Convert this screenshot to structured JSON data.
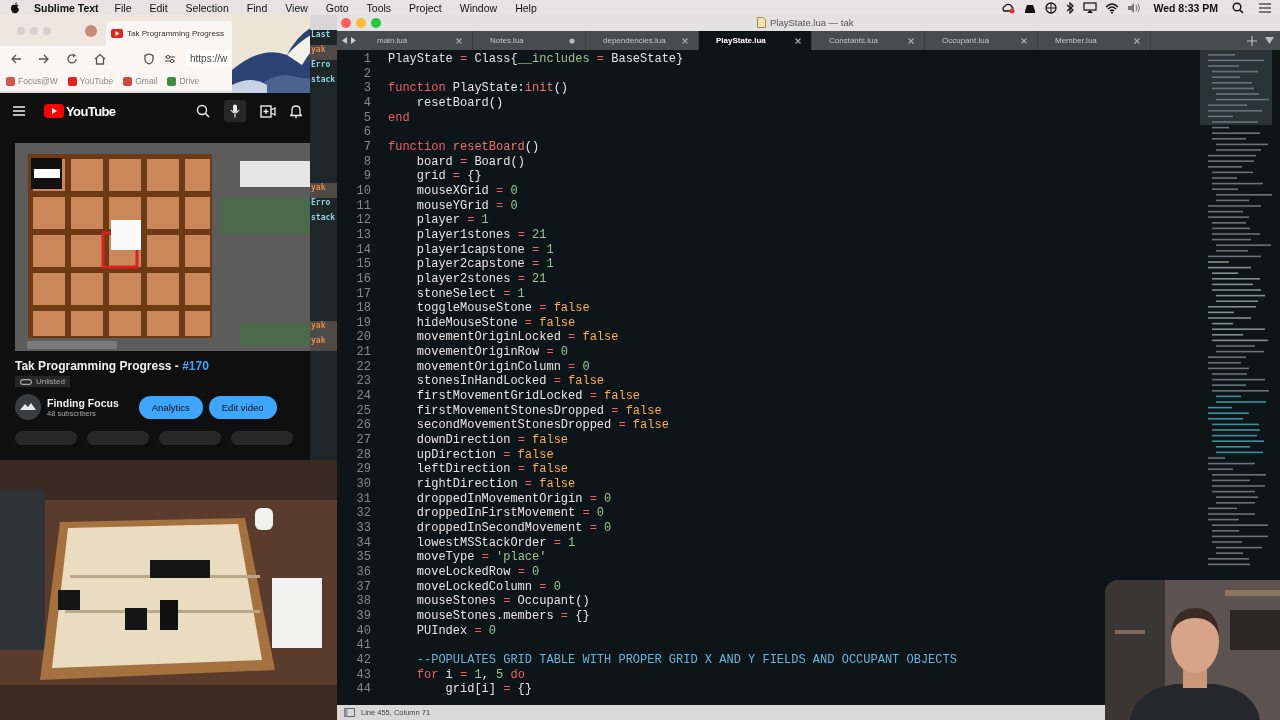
{
  "menu_bar": {
    "app": "Sublime Text",
    "menus": [
      "File",
      "Edit",
      "Selection",
      "Find",
      "View",
      "Goto",
      "Tools",
      "Project",
      "Window",
      "Help"
    ],
    "clock": "Wed 8:33 PM"
  },
  "browser": {
    "tab_title": "Tak Programming Progress",
    "address": "https://w",
    "bookmarks": [
      "Focus@W",
      "YouTube",
      "Gmail",
      "Drive"
    ],
    "youtube": {
      "logo": "YouTube",
      "video": {
        "title": "Tak Programming Progress - ",
        "tag": "#170",
        "visibility": "Unlisted",
        "channel": "Finding Focus",
        "subscribers": "48 subscribers",
        "buttons": [
          "Analytics",
          "Edit video"
        ]
      }
    }
  },
  "terminal": {
    "blocks": [
      {
        "lines": [
          {
            "text": "Last",
            "kind": "info"
          },
          {
            "text": "yak",
            "kind": "warn"
          },
          {
            "text": "Erro",
            "kind": "info"
          },
          {
            "text": "stack",
            "kind": "info"
          }
        ]
      },
      {
        "lines": [
          {
            "text": "yak",
            "kind": "warn"
          },
          {
            "text": "Erro",
            "kind": "info"
          },
          {
            "text": "stack",
            "kind": "info"
          }
        ]
      },
      {
        "lines": [
          {
            "text": "yak",
            "kind": "warn"
          },
          {
            "text": "yak",
            "kind": "warn"
          }
        ]
      }
    ]
  },
  "editor": {
    "title": "PlayState.lua — tak",
    "tabs": [
      {
        "label": "main.lua",
        "selected": false,
        "modified": false
      },
      {
        "label": "Notes.lua",
        "selected": false,
        "modified": true
      },
      {
        "label": "dependencies.lua",
        "selected": false,
        "modified": false
      },
      {
        "label": "PlayState.lua",
        "selected": true,
        "modified": false
      },
      {
        "label": "Constants.lua",
        "selected": false,
        "modified": false
      },
      {
        "label": "Occupant.lua",
        "selected": false,
        "modified": false
      },
      {
        "label": "Member.lua",
        "selected": false,
        "modified": false
      }
    ],
    "lines": [
      {
        "number": "1",
        "tokens": [
          {
            "text": "PlayState ",
            "kind": "plain"
          },
          {
            "text": "=",
            "kind": "op"
          },
          {
            "text": " Class{",
            "kind": "plain"
          },
          {
            "text": "__includes",
            "kind": "key"
          },
          {
            "text": " =",
            "kind": "op"
          },
          {
            "text": " BaseState}",
            "kind": "plain"
          }
        ]
      },
      {
        "number": "2"
      },
      {
        "number": "3",
        "tokens": [
          {
            "text": "function",
            "kind": "keyword"
          },
          {
            "text": " PlayState:",
            "kind": "plain"
          },
          {
            "text": "init",
            "kind": "func"
          },
          {
            "text": "()",
            "kind": "plain"
          }
        ]
      },
      {
        "number": "4",
        "tokens": [
          {
            "text": "    resetBoard()",
            "kind": "plain"
          }
        ]
      },
      {
        "number": "5",
        "tokens": [
          {
            "text": "end",
            "kind": "keyword"
          }
        ]
      },
      {
        "number": "6"
      },
      {
        "number": "7",
        "tokens": [
          {
            "text": "function",
            "kind": "keyword"
          },
          {
            "text": " resetBoard",
            "kind": "func"
          },
          {
            "text": "()",
            "kind": "plain"
          }
        ]
      },
      {
        "number": "8",
        "tokens": [
          {
            "text": "    board ",
            "kind": "plain"
          },
          {
            "text": "=",
            "kind": "op"
          },
          {
            "text": " Board()",
            "kind": "plain"
          }
        ]
      },
      {
        "number": "9",
        "tokens": [
          {
            "text": "    grid ",
            "kind": "plain"
          },
          {
            "text": "=",
            "kind": "op"
          },
          {
            "text": " {}",
            "kind": "plain"
          }
        ]
      },
      {
        "number": "10",
        "tokens": [
          {
            "text": "    mouseXGrid ",
            "kind": "plain"
          },
          {
            "text": "=",
            "kind": "op"
          },
          {
            "text": " 0",
            "kind": "number"
          }
        ]
      },
      {
        "number": "11",
        "tokens": [
          {
            "text": "    mouseYGrid ",
            "kind": "plain"
          },
          {
            "text": "=",
            "kind": "op"
          },
          {
            "text": " 0",
            "kind": "number"
          }
        ]
      },
      {
        "number": "12",
        "tokens": [
          {
            "text": "    player ",
            "kind": "plain"
          },
          {
            "text": "=",
            "kind": "op"
          },
          {
            "text": " 1",
            "kind": "number"
          }
        ]
      },
      {
        "number": "13",
        "tokens": [
          {
            "text": "    player1stones ",
            "kind": "plain"
          },
          {
            "text": "=",
            "kind": "op"
          },
          {
            "text": " 21",
            "kind": "number"
          }
        ]
      },
      {
        "number": "14",
        "tokens": [
          {
            "text": "    player1capstone ",
            "kind": "plain"
          },
          {
            "text": "=",
            "kind": "op"
          },
          {
            "text": " 1",
            "kind": "number"
          }
        ]
      },
      {
        "number": "15",
        "tokens": [
          {
            "text": "    player2capstone ",
            "kind": "plain"
          },
          {
            "text": "=",
            "kind": "op"
          },
          {
            "text": " 1",
            "kind": "number"
          }
        ]
      },
      {
        "number": "16",
        "tokens": [
          {
            "text": "    player2stones ",
            "kind": "plain"
          },
          {
            "text": "=",
            "kind": "op"
          },
          {
            "text": " 21",
            "kind": "number"
          }
        ]
      },
      {
        "number": "17",
        "tokens": [
          {
            "text": "    stoneSelect ",
            "kind": "plain"
          },
          {
            "text": "=",
            "kind": "op"
          },
          {
            "text": " 1",
            "kind": "number"
          }
        ]
      },
      {
        "number": "18",
        "tokens": [
          {
            "text": "    toggleMouseStone ",
            "kind": "plain"
          },
          {
            "text": "=",
            "kind": "op"
          },
          {
            "text": " false",
            "kind": "bool"
          }
        ]
      },
      {
        "number": "19",
        "tokens": [
          {
            "text": "    hideMouseStone ",
            "kind": "plain"
          },
          {
            "text": "=",
            "kind": "op"
          },
          {
            "text": " false",
            "kind": "bool"
          }
        ]
      },
      {
        "number": "20",
        "tokens": [
          {
            "text": "    movementOriginLocked ",
            "kind": "plain"
          },
          {
            "text": "=",
            "kind": "op"
          },
          {
            "text": " false",
            "kind": "bool"
          }
        ]
      },
      {
        "number": "21",
        "tokens": [
          {
            "text": "    movementOriginRow ",
            "kind": "plain"
          },
          {
            "text": "=",
            "kind": "op"
          },
          {
            "text": " 0",
            "kind": "number"
          }
        ]
      },
      {
        "number": "22",
        "tokens": [
          {
            "text": "    movementOriginColumn ",
            "kind": "plain"
          },
          {
            "text": "=",
            "kind": "op"
          },
          {
            "text": " 0",
            "kind": "number"
          }
        ]
      },
      {
        "number": "23",
        "tokens": [
          {
            "text": "    stonesInHandLocked ",
            "kind": "plain"
          },
          {
            "text": "=",
            "kind": "op"
          },
          {
            "text": " false",
            "kind": "bool"
          }
        ]
      },
      {
        "number": "24",
        "tokens": [
          {
            "text": "    firstMovementGridLocked ",
            "kind": "plain"
          },
          {
            "text": "=",
            "kind": "op"
          },
          {
            "text": " false",
            "kind": "bool"
          }
        ]
      },
      {
        "number": "25",
        "tokens": [
          {
            "text": "    firstMovementStonesDropped ",
            "kind": "plain"
          },
          {
            "text": "=",
            "kind": "op"
          },
          {
            "text": " false",
            "kind": "bool"
          }
        ]
      },
      {
        "number": "26",
        "tokens": [
          {
            "text": "    secondMovementStonesDropped ",
            "kind": "plain"
          },
          {
            "text": "=",
            "kind": "op"
          },
          {
            "text": " false",
            "kind": "bool"
          }
        ]
      },
      {
        "number": "27",
        "tokens": [
          {
            "text": "    downDirection ",
            "kind": "plain"
          },
          {
            "text": "=",
            "kind": "op"
          },
          {
            "text": " false",
            "kind": "bool"
          }
        ]
      },
      {
        "number": "28",
        "tokens": [
          {
            "text": "    upDirection ",
            "kind": "plain"
          },
          {
            "text": "=",
            "kind": "op"
          },
          {
            "text": " false",
            "kind": "bool"
          }
        ]
      },
      {
        "number": "29",
        "tokens": [
          {
            "text": "    leftDirection ",
            "kind": "plain"
          },
          {
            "text": "=",
            "kind": "op"
          },
          {
            "text": " false",
            "kind": "bool"
          }
        ]
      },
      {
        "number": "30",
        "tokens": [
          {
            "text": "    rightDirection ",
            "kind": "plain"
          },
          {
            "text": "=",
            "kind": "op"
          },
          {
            "text": " false",
            "kind": "bool"
          }
        ]
      },
      {
        "number": "31",
        "tokens": [
          {
            "text": "    droppedInMovementOrigin ",
            "kind": "plain"
          },
          {
            "text": "=",
            "kind": "op"
          },
          {
            "text": " 0",
            "kind": "number"
          }
        ]
      },
      {
        "number": "32",
        "tokens": [
          {
            "text": "    droppedInFirstMovement ",
            "kind": "plain"
          },
          {
            "text": "=",
            "kind": "op"
          },
          {
            "text": " 0",
            "kind": "number"
          }
        ]
      },
      {
        "number": "33",
        "tokens": [
          {
            "text": "    droppedInSecondMovement ",
            "kind": "plain"
          },
          {
            "text": "=",
            "kind": "op"
          },
          {
            "text": " 0",
            "kind": "number"
          }
        ]
      },
      {
        "number": "34",
        "tokens": [
          {
            "text": "    lowestMSStackOrder ",
            "kind": "plain"
          },
          {
            "text": "=",
            "kind": "op"
          },
          {
            "text": " 1",
            "kind": "number"
          }
        ]
      },
      {
        "number": "35",
        "tokens": [
          {
            "text": "    moveType ",
            "kind": "plain"
          },
          {
            "text": "=",
            "kind": "op"
          },
          {
            "text": " 'place'",
            "kind": "string"
          }
        ]
      },
      {
        "number": "36",
        "tokens": [
          {
            "text": "    moveLockedRow ",
            "kind": "plain"
          },
          {
            "text": "=",
            "kind": "op"
          },
          {
            "text": " 0",
            "kind": "number"
          }
        ]
      },
      {
        "number": "37",
        "tokens": [
          {
            "text": "    moveLockedColumn ",
            "kind": "plain"
          },
          {
            "text": "=",
            "kind": "op"
          },
          {
            "text": " 0",
            "kind": "number"
          }
        ]
      },
      {
        "number": "38",
        "tokens": [
          {
            "text": "    mouseStones ",
            "kind": "plain"
          },
          {
            "text": "=",
            "kind": "op"
          },
          {
            "text": " Occupant()",
            "kind": "plain"
          }
        ]
      },
      {
        "number": "39",
        "tokens": [
          {
            "text": "    mouseStones.members ",
            "kind": "plain"
          },
          {
            "text": "=",
            "kind": "op"
          },
          {
            "text": " {}",
            "kind": "plain"
          }
        ]
      },
      {
        "number": "40",
        "tokens": [
          {
            "text": "    PUIndex ",
            "kind": "plain"
          },
          {
            "text": "=",
            "kind": "op"
          },
          {
            "text": " 0",
            "kind": "number"
          }
        ]
      },
      {
        "number": "41"
      },
      {
        "number": "42",
        "tokens": [
          {
            "text": "    --POPULATES GRID TABLE WITH PROPER GRID X AND Y FIELDS AND OCCUPANT OBJECTS",
            "kind": "comment"
          }
        ]
      },
      {
        "number": "43",
        "tokens": [
          {
            "text": "    for",
            "kind": "keyword"
          },
          {
            "text": " i ",
            "kind": "plain"
          },
          {
            "text": "=",
            "kind": "op"
          },
          {
            "text": " 1",
            "kind": "number"
          },
          {
            "text": ", ",
            "kind": "plain"
          },
          {
            "text": "5",
            "kind": "number"
          },
          {
            "text": " do",
            "kind": "keyword"
          }
        ]
      },
      {
        "number": "44",
        "tokens": [
          {
            "text": "        grid[i] ",
            "kind": "plain"
          },
          {
            "text": "=",
            "kind": "op"
          },
          {
            "text": " {}",
            "kind": "plain"
          }
        ]
      }
    ],
    "status": "Line 455, Column 71"
  }
}
